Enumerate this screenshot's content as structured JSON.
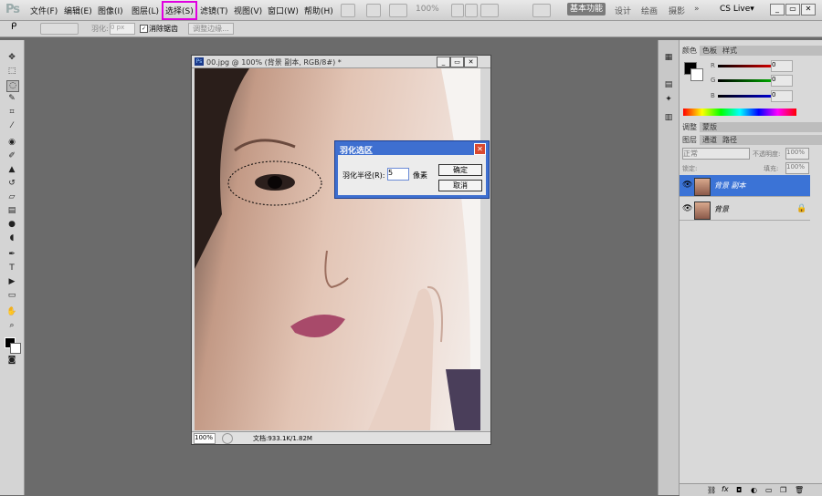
{
  "menubar": {
    "logo": "Ps",
    "items": [
      "文件(F)",
      "编辑(E)",
      "图像(I)",
      "图层(L)",
      "选择(S)",
      "滤镜(T)",
      "视图(V)",
      "窗口(W)",
      "帮助(H)"
    ],
    "zoom": "100%",
    "workspaces": [
      "基本功能",
      "设计",
      "绘画",
      "摄影"
    ],
    "more": "»",
    "cs_live": "CS Live▾"
  },
  "options": {
    "feather_label": "羽化:",
    "feather_value": "0 px",
    "antialias_label": "消除锯齿",
    "refine_edge": "调整边缘..."
  },
  "document": {
    "title": "00.jpg @ 100% (背景 副本, RGB/8#) *",
    "ps_icon": "Ps",
    "zoom": "100%",
    "info": "文档:933.1K/1.82M"
  },
  "dialog": {
    "title": "羽化选区",
    "radius_label": "羽化半径(R):",
    "radius_value": "5",
    "unit": "像素",
    "ok": "确定",
    "cancel": "取消"
  },
  "panels": {
    "color_tabs": [
      "颜色",
      "色板",
      "样式"
    ],
    "color_channels": [
      "R",
      "G",
      "B"
    ],
    "color_values": [
      "0",
      "0",
      "0"
    ],
    "adjust_tabs": [
      "调整",
      "蒙版"
    ],
    "layer_tabs": [
      "图层",
      "通道",
      "路径"
    ],
    "blend_mode": "正常",
    "opacity_label": "不透明度:",
    "opacity_value": "100%",
    "lock_label": "锁定:",
    "fill_label": "填充:",
    "fill_value": "100%",
    "layers": [
      "背景 副本",
      "背景"
    ]
  }
}
